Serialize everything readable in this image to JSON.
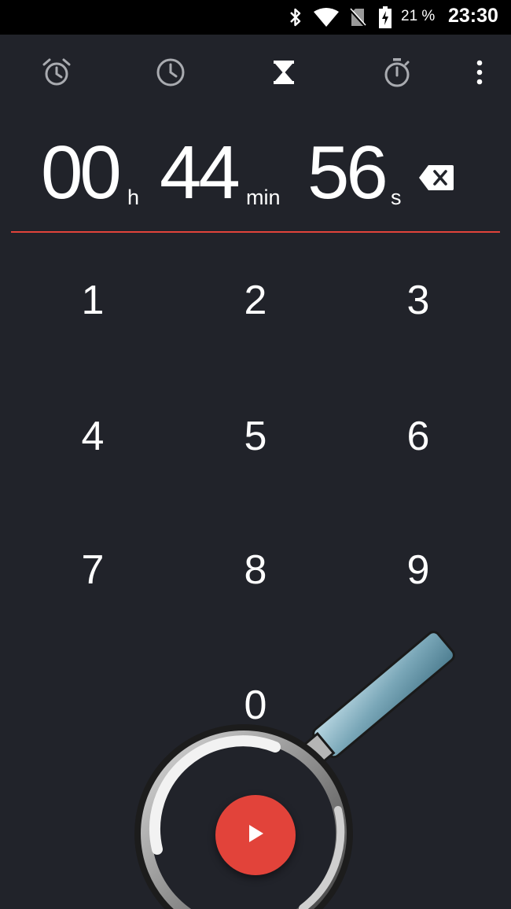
{
  "status_bar": {
    "battery_percent": "21 %",
    "time": "23:30",
    "icons": [
      "bluetooth-icon",
      "wifi-icon",
      "no-sim-icon",
      "battery-charging-icon"
    ]
  },
  "toolbar": {
    "tabs": [
      {
        "name": "alarm",
        "icon": "alarm-clock-icon",
        "selected": false
      },
      {
        "name": "clock",
        "icon": "clock-icon",
        "selected": false
      },
      {
        "name": "timer",
        "icon": "hourglass-icon",
        "selected": true
      },
      {
        "name": "stopwatch",
        "icon": "stopwatch-icon",
        "selected": false
      }
    ],
    "overflow_icon": "more-vert-icon"
  },
  "timer_input": {
    "hours": "00",
    "hours_unit": "h",
    "minutes": "44",
    "minutes_unit": "min",
    "seconds": "56",
    "seconds_unit": "s",
    "accent_color": "#e2433a"
  },
  "keypad": {
    "keys": [
      "1",
      "2",
      "3",
      "4",
      "5",
      "6",
      "7",
      "8",
      "9",
      "0"
    ]
  },
  "start_button": {
    "icon": "play-icon",
    "color": "#e2433a"
  },
  "colors": {
    "background": "#21232a",
    "status_bar": "#000000",
    "accent": "#e2433a"
  }
}
